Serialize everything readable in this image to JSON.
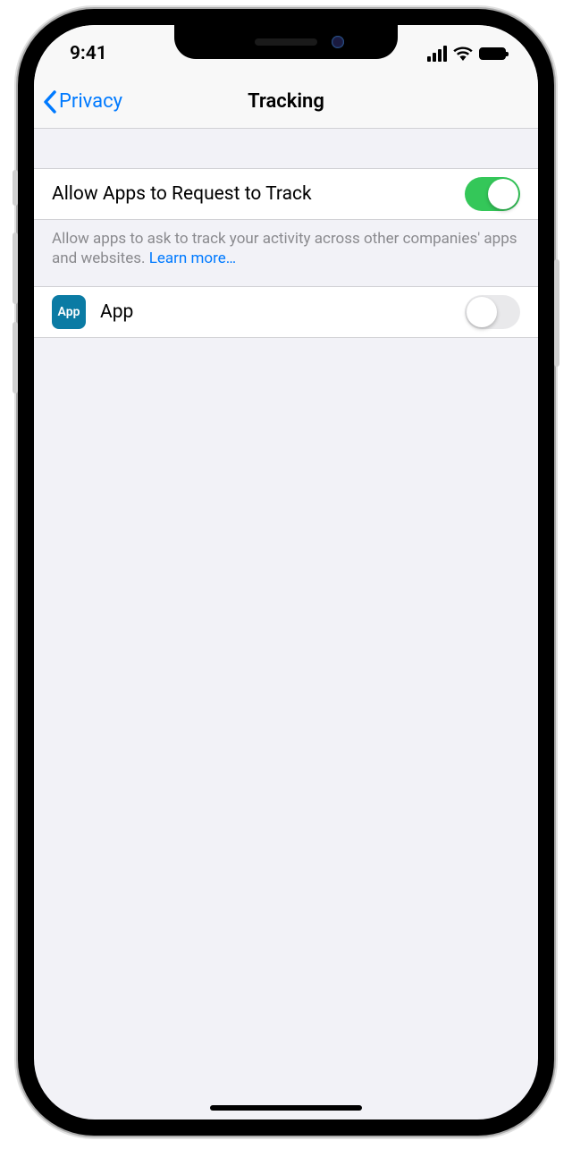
{
  "status": {
    "time": "9:41"
  },
  "nav": {
    "back_label": "Privacy",
    "title": "Tracking"
  },
  "master": {
    "label": "Allow Apps to Request to Track",
    "footer_text": "Allow apps to ask to track your activity across other companies' apps and websites. ",
    "learn_more": "Learn more…",
    "enabled": true
  },
  "apps": [
    {
      "name": "App",
      "icon_label": "App",
      "enabled": false
    }
  ]
}
